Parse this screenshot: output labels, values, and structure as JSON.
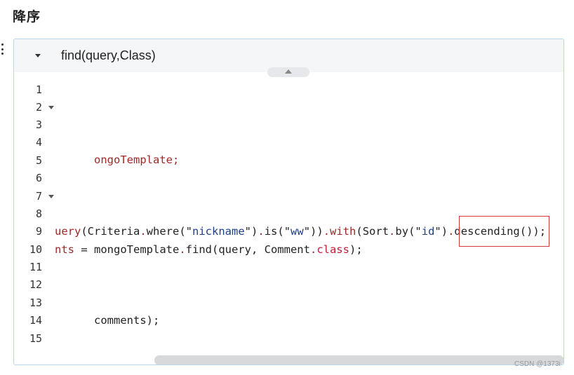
{
  "page": {
    "heading": "降序"
  },
  "code_block": {
    "title": "find(query,Class)",
    "line_numbers": [
      "1",
      "2",
      "3",
      "4",
      "5",
      "6",
      "7",
      "8",
      "9",
      "10",
      "11",
      "12",
      "13",
      "14",
      "15"
    ],
    "lines": {
      "line4": "ongoTemplate;",
      "line9": {
        "p1": "uery",
        "p2": "(Criteria",
        "p3": ".",
        "p4": "where",
        "p5": "(\"",
        "p6": "nickname",
        "p7": "\")",
        "p8": ".",
        "p9": "is",
        "p10": "(\"",
        "p11": "ww",
        "p12": "\"))",
        "p13": ".",
        "p14": "with",
        "p15": "(Sort",
        "p16": ".",
        "p17": "by",
        "p18": "(\"",
        "p19": "id",
        "p20": "\")",
        "p21": ".",
        "p22": "descending",
        "p23": "());"
      },
      "line10": {
        "p1": "nts",
        "p2": " = mongoTemplate",
        "p3": ".",
        "p4": "find",
        "p5": "(query, Comment",
        "p6": ".",
        "p7": "class",
        "p8": ");"
      },
      "line13": "comments);"
    }
  },
  "watermark": "CSDN @1373i",
  "icons": {
    "header_toggle": "caret-down-icon",
    "collapse": "caret-up-icon",
    "fold": "fold-caret-icon",
    "more": "more-vertical-icon"
  },
  "colors": {
    "method": "#a02828",
    "string": "#1f3f8a",
    "keyword": "#c41a3a",
    "highlight_box": "#d23c3c",
    "block_border": "#b9d6ee"
  }
}
